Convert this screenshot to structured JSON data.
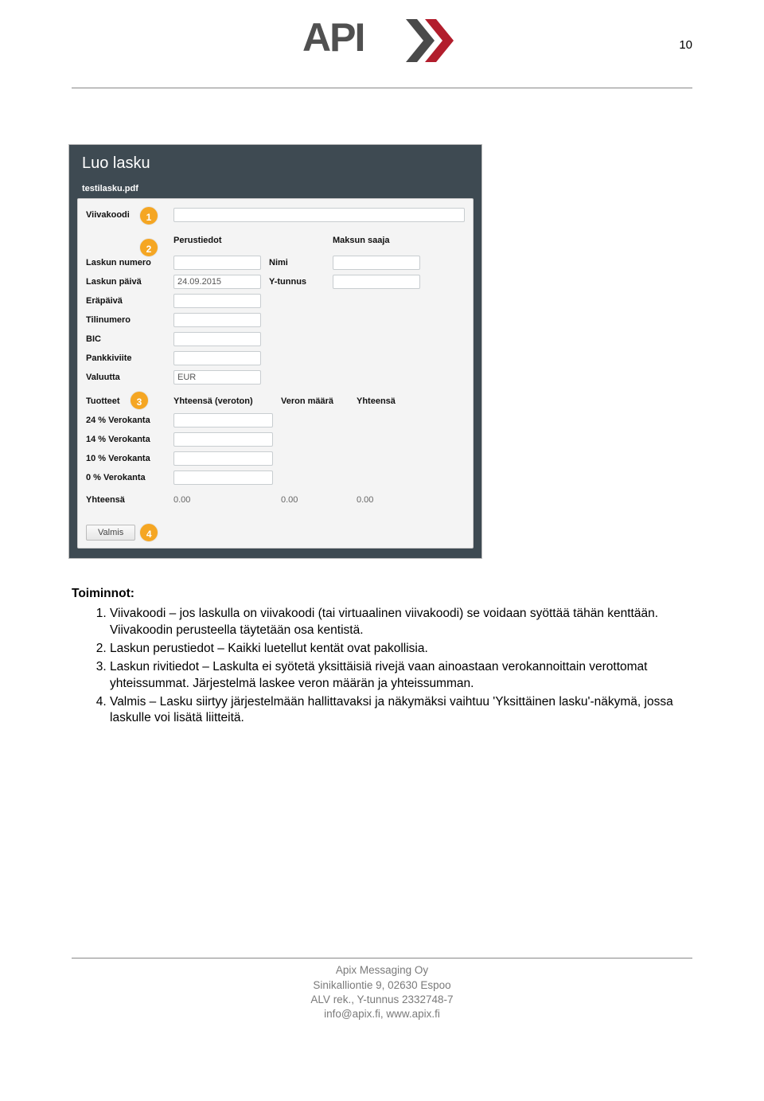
{
  "page_number": "10",
  "shot": {
    "title": "Luo lasku",
    "filename": "testilasku.pdf",
    "badges": {
      "b1": "1",
      "b2": "2",
      "b3": "3",
      "b4": "4"
    },
    "viivakoodi_label": "Viivakoodi",
    "viivakoodi_value": "",
    "section_perustiedot": "Perustiedot",
    "section_maksun_saaja": "Maksun saaja",
    "fields": {
      "laskun_numero": "Laskun numero",
      "laskun_paiva": "Laskun päivä",
      "laskun_paiva_value": "24.09.2015",
      "erapaiva": "Eräpäivä",
      "tilinumero": "Tilinumero",
      "bic": "BIC",
      "pankkiviite": "Pankkiviite",
      "valuutta": "Valuutta",
      "valuutta_value": "EUR",
      "nimi": "Nimi",
      "ytunnus": "Y-tunnus"
    },
    "products": {
      "tuotteet": "Tuotteet",
      "yht_veroton": "Yhteensä (veroton)",
      "veron_maara": "Veron määrä",
      "yhteensa": "Yhteensä",
      "rows": [
        "24 % Verokanta",
        "14 % Verokanta",
        "10 % Verokanta",
        "0 % Verokanta"
      ],
      "total_label": "Yhteensä",
      "total_a": "0.00",
      "total_b": "0.00",
      "total_c": "0.00"
    },
    "valmis_label": "Valmis"
  },
  "text": {
    "heading": "Toiminnot:",
    "items": [
      "Viivakoodi – jos laskulla on viivakoodi (tai virtuaalinen viivakoodi) se voidaan syöttää tähän kenttään. Viivakoodin perusteella täytetään osa kentistä.",
      "Laskun perustiedot – Kaikki luetellut kentät ovat pakollisia.",
      "Laskun rivitiedot – Laskulta ei syötetä yksittäisiä rivejä vaan ainoastaan verokannoittain verottomat yhteissummat. Järjestelmä laskee veron määrän ja yhteissumman.",
      "Valmis – Lasku siirtyy järjestelmään hallittavaksi ja näkymäksi vaihtuu 'Yksittäinen lasku'-näkymä, jossa laskulle voi lisätä liitteitä."
    ]
  },
  "footer": {
    "l1": "Apix Messaging Oy",
    "l2": "Sinikalliontie 9, 02630 Espoo",
    "l3": "ALV rek., Y-tunnus 2332748-7",
    "l4": "info@apix.fi, www.apix.fi"
  }
}
